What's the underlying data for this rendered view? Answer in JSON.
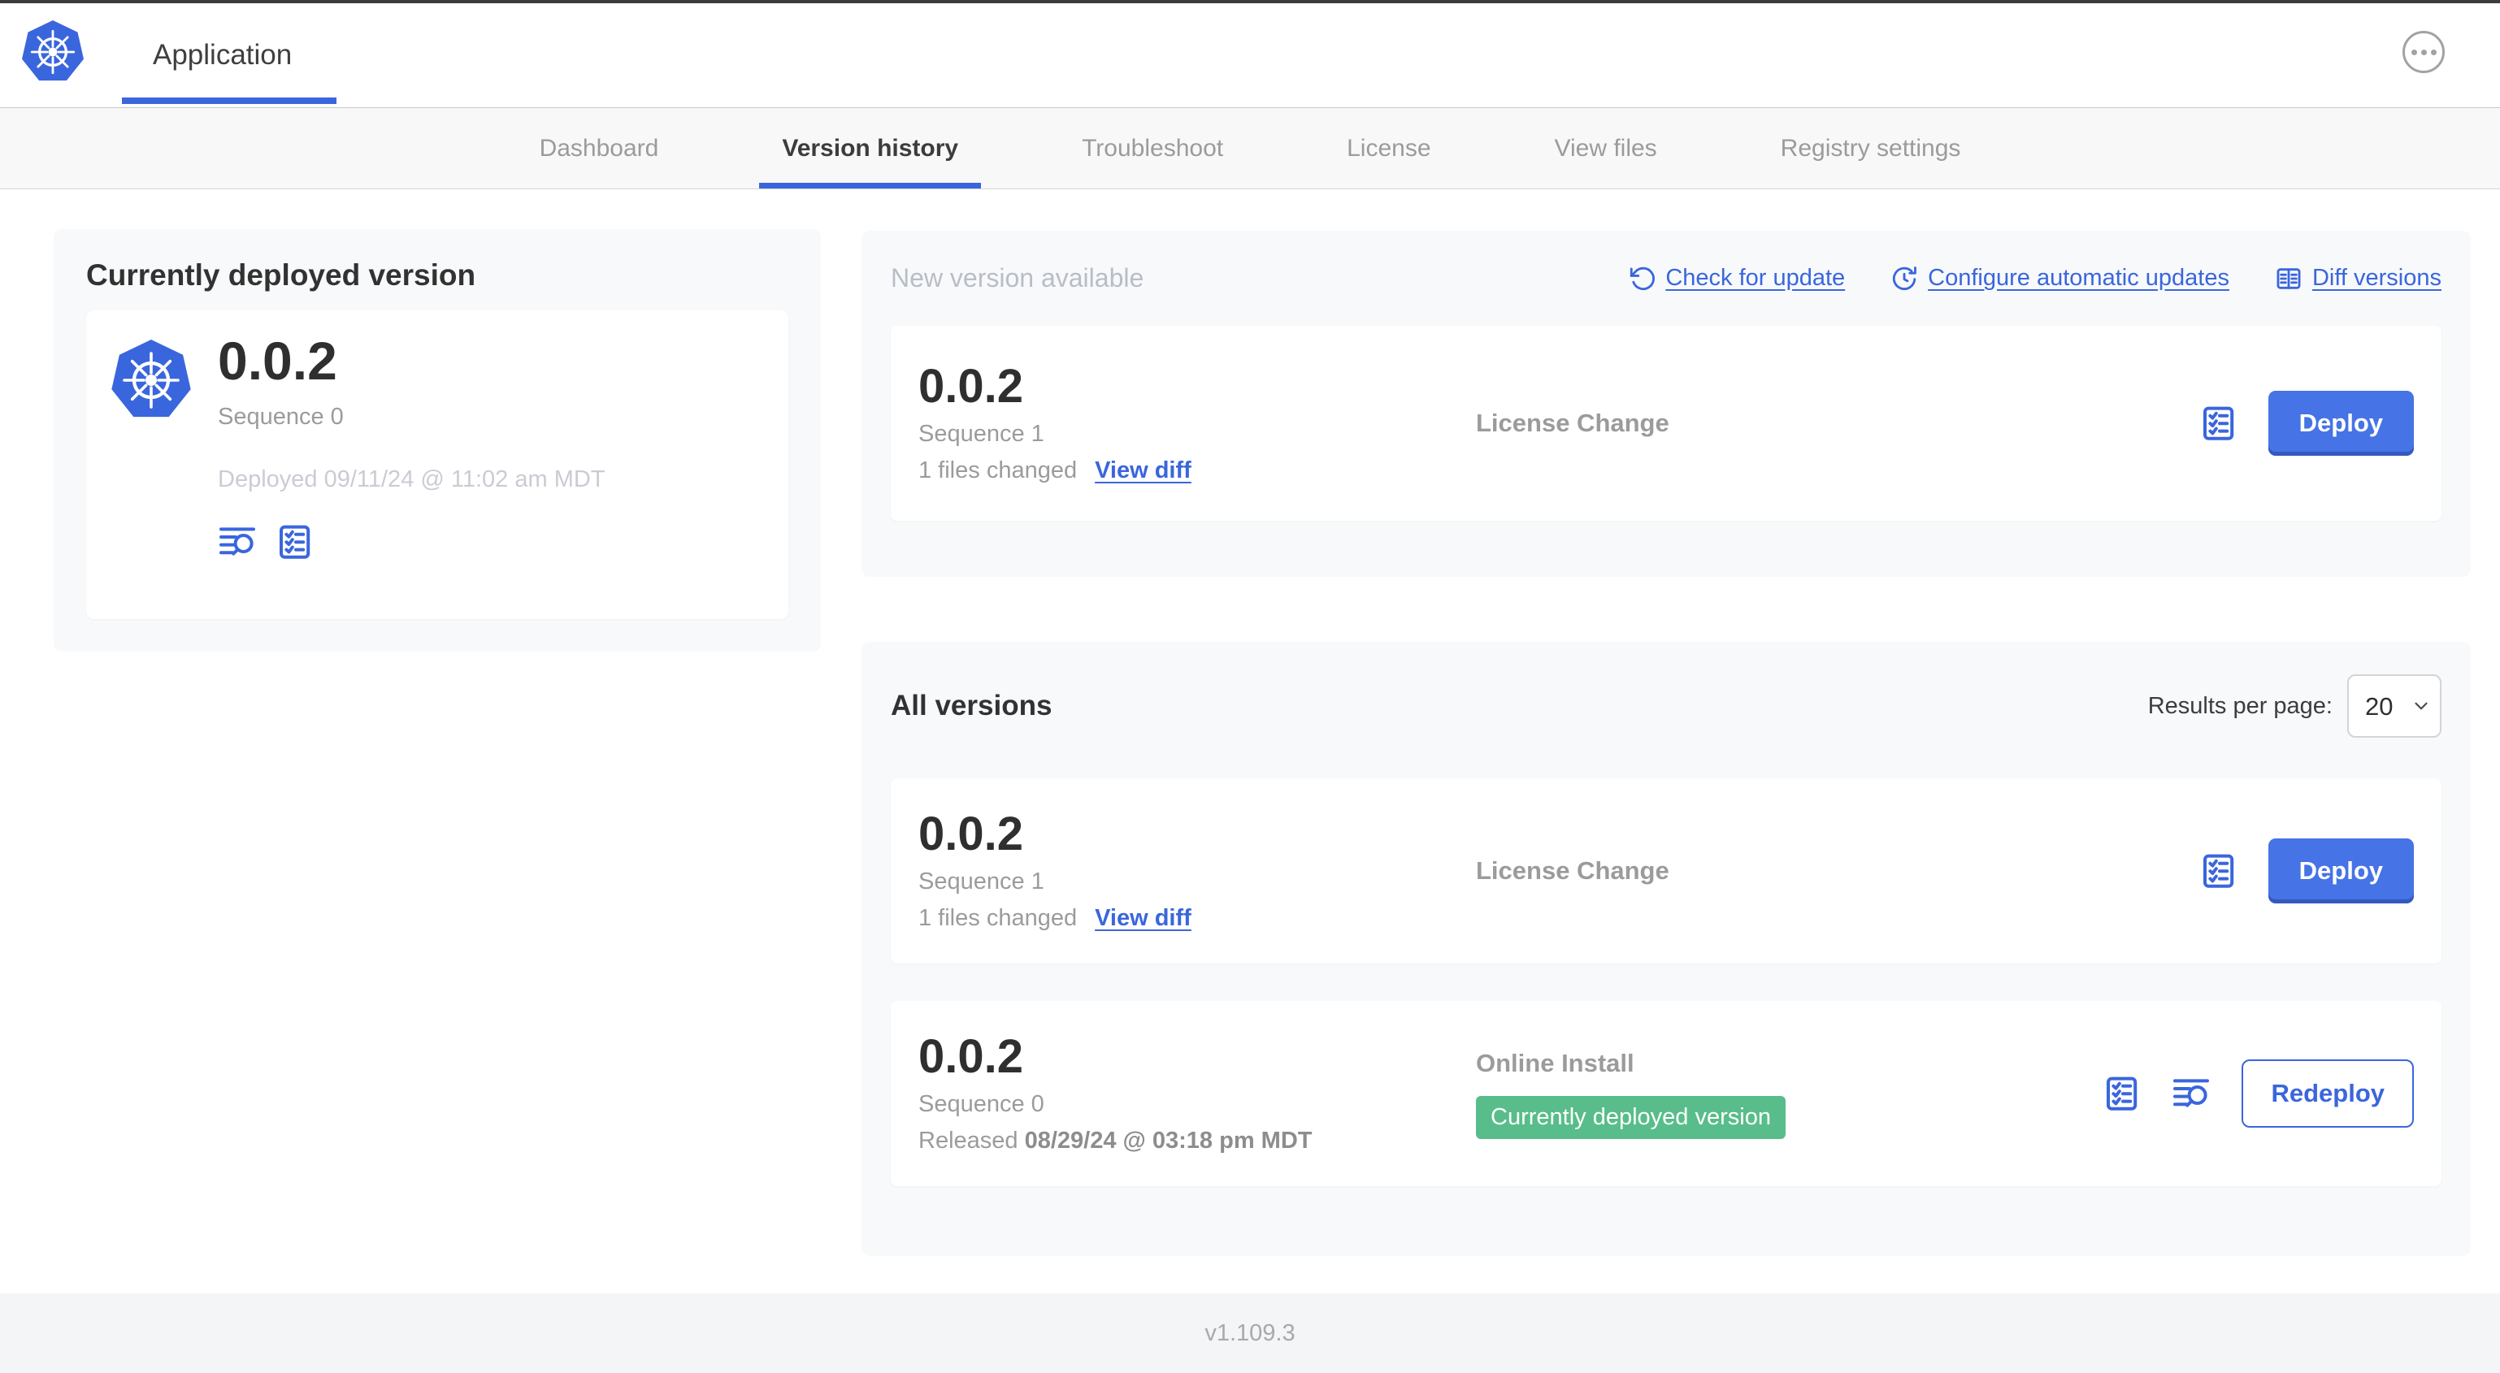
{
  "colors": {
    "accent_blue": "#3a66dd",
    "button_blue": "#4673e5",
    "badge_green": "#58bd8a"
  },
  "header": {
    "app_title": "Application"
  },
  "tabs": [
    {
      "label": "Dashboard",
      "active": false
    },
    {
      "label": "Version history",
      "active": true
    },
    {
      "label": "Troubleshoot",
      "active": false
    },
    {
      "label": "License",
      "active": false
    },
    {
      "label": "View files",
      "active": false
    },
    {
      "label": "Registry settings",
      "active": false
    }
  ],
  "deployed": {
    "heading": "Currently deployed version",
    "version": "0.0.2",
    "sequence": "Sequence 0",
    "deployed_at": "Deployed 09/11/24 @ 11:02 am MDT"
  },
  "new_version": {
    "heading": "New version available",
    "check_for_update": "Check for update",
    "configure_auto_updates": "Configure automatic updates",
    "diff_versions": "Diff versions",
    "row": {
      "version": "0.0.2",
      "sequence": "Sequence 1",
      "files_changed": "1 files changed",
      "view_diff": "View diff",
      "source": "License Change",
      "action": "Deploy"
    }
  },
  "all_versions": {
    "heading": "All versions",
    "results_per_page_label": "Results per page:",
    "results_per_page_value": "20",
    "rows": [
      {
        "version": "0.0.2",
        "sequence": "Sequence 1",
        "files_changed": "1 files changed",
        "view_diff": "View diff",
        "source": "License Change",
        "action": "Deploy"
      },
      {
        "version": "0.0.2",
        "sequence": "Sequence 0",
        "released_label": "Released",
        "released_date": "08/29/24 @ 03:18 pm MDT",
        "source": "Online Install",
        "badge": "Currently deployed version",
        "action": "Redeploy"
      }
    ]
  },
  "footer": {
    "app_manager_version": "v1.109.3"
  }
}
